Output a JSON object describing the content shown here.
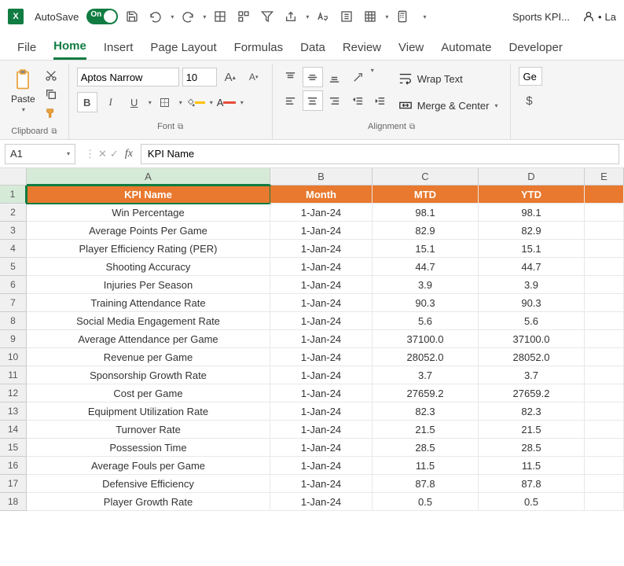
{
  "titleBar": {
    "autosave": "AutoSave",
    "toggleState": "On",
    "docTitle": "Sports KPI...",
    "user": "La"
  },
  "tabs": {
    "file": "File",
    "home": "Home",
    "insert": "Insert",
    "pageLayout": "Page Layout",
    "formulas": "Formulas",
    "data": "Data",
    "review": "Review",
    "view": "View",
    "automate": "Automate",
    "developer": "Developer"
  },
  "ribbon": {
    "paste": "Paste",
    "clipboard": "Clipboard",
    "fontName": "Aptos Narrow",
    "fontSize": "10",
    "fontGroup": "Font",
    "wrapText": "Wrap Text",
    "mergeCenter": "Merge & Center",
    "alignment": "Alignment",
    "generalFmt": "Ge",
    "currency": "$"
  },
  "formulaBar": {
    "nameBox": "A1",
    "formula": "KPI Name"
  },
  "grid": {
    "cols": [
      "A",
      "B",
      "C",
      "D",
      "E"
    ],
    "headers": {
      "A": "KPI Name",
      "B": "Month",
      "C": "MTD",
      "D": "YTD"
    },
    "rows": [
      {
        "n": "1"
      },
      {
        "n": "2",
        "A": "Win Percentage",
        "B": "1-Jan-24",
        "C": "98.1",
        "D": "98.1"
      },
      {
        "n": "3",
        "A": "Average Points Per Game",
        "B": "1-Jan-24",
        "C": "82.9",
        "D": "82.9"
      },
      {
        "n": "4",
        "A": "Player Efficiency Rating (PER)",
        "B": "1-Jan-24",
        "C": "15.1",
        "D": "15.1"
      },
      {
        "n": "5",
        "A": "Shooting Accuracy",
        "B": "1-Jan-24",
        "C": "44.7",
        "D": "44.7"
      },
      {
        "n": "6",
        "A": "Injuries Per Season",
        "B": "1-Jan-24",
        "C": "3.9",
        "D": "3.9"
      },
      {
        "n": "7",
        "A": "Training Attendance Rate",
        "B": "1-Jan-24",
        "C": "90.3",
        "D": "90.3"
      },
      {
        "n": "8",
        "A": "Social Media Engagement Rate",
        "B": "1-Jan-24",
        "C": "5.6",
        "D": "5.6"
      },
      {
        "n": "9",
        "A": "Average Attendance per Game",
        "B": "1-Jan-24",
        "C": "37100.0",
        "D": "37100.0"
      },
      {
        "n": "10",
        "A": "Revenue per Game",
        "B": "1-Jan-24",
        "C": "28052.0",
        "D": "28052.0"
      },
      {
        "n": "11",
        "A": "Sponsorship Growth Rate",
        "B": "1-Jan-24",
        "C": "3.7",
        "D": "3.7"
      },
      {
        "n": "12",
        "A": "Cost per Game",
        "B": "1-Jan-24",
        "C": "27659.2",
        "D": "27659.2"
      },
      {
        "n": "13",
        "A": "Equipment Utilization Rate",
        "B": "1-Jan-24",
        "C": "82.3",
        "D": "82.3"
      },
      {
        "n": "14",
        "A": "Turnover Rate",
        "B": "1-Jan-24",
        "C": "21.5",
        "D": "21.5"
      },
      {
        "n": "15",
        "A": "Possession Time",
        "B": "1-Jan-24",
        "C": "28.5",
        "D": "28.5"
      },
      {
        "n": "16",
        "A": "Average Fouls per Game",
        "B": "1-Jan-24",
        "C": "11.5",
        "D": "11.5"
      },
      {
        "n": "17",
        "A": "Defensive Efficiency",
        "B": "1-Jan-24",
        "C": "87.8",
        "D": "87.8"
      },
      {
        "n": "18",
        "A": "Player Growth Rate",
        "B": "1-Jan-24",
        "C": "0.5",
        "D": "0.5"
      }
    ]
  }
}
